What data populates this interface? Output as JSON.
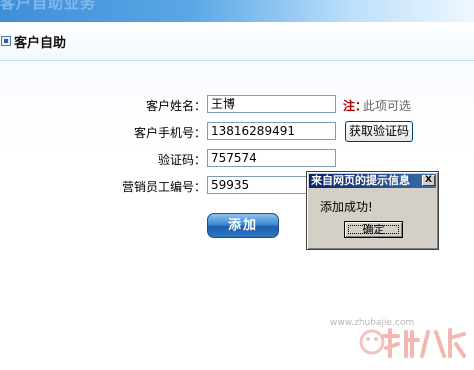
{
  "banner": {
    "text": "客户自助业务"
  },
  "section": {
    "title": "客户自助"
  },
  "form": {
    "name": {
      "label": "客户姓名：",
      "value": "王博"
    },
    "note": {
      "prefix": "注：",
      "text": "此项可选"
    },
    "phone": {
      "label": "客户手机号：",
      "value": "13816289491",
      "button": "获取验证码"
    },
    "code": {
      "label": "验证码：",
      "value": "757574"
    },
    "employee": {
      "label": "营销员工编号：",
      "value": "59935"
    },
    "submit": "添加"
  },
  "dialog": {
    "title": "来自网页的提示信息",
    "close": "X",
    "message": "添加成功!",
    "ok": "确定"
  },
  "watermark": {
    "url": "www.zhubajie.com",
    "logo_text": "猪八戒"
  }
}
